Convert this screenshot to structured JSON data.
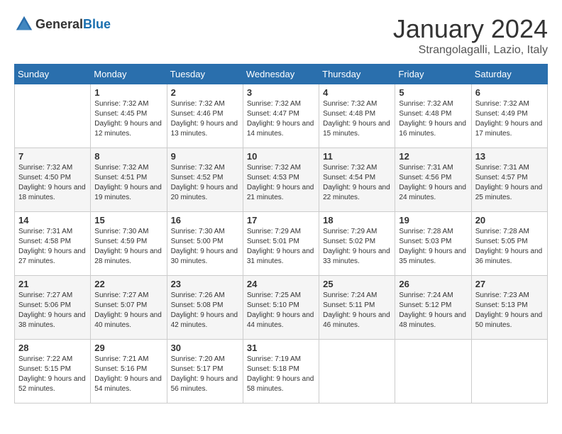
{
  "logo": {
    "text_general": "General",
    "text_blue": "Blue"
  },
  "title": "January 2024",
  "subtitle": "Strangolagalli, Lazio, Italy",
  "days_of_week": [
    "Sunday",
    "Monday",
    "Tuesday",
    "Wednesday",
    "Thursday",
    "Friday",
    "Saturday"
  ],
  "weeks": [
    [
      {
        "day": "",
        "sunrise": "",
        "sunset": "",
        "daylight": ""
      },
      {
        "day": "1",
        "sunrise": "Sunrise: 7:32 AM",
        "sunset": "Sunset: 4:45 PM",
        "daylight": "Daylight: 9 hours and 12 minutes."
      },
      {
        "day": "2",
        "sunrise": "Sunrise: 7:32 AM",
        "sunset": "Sunset: 4:46 PM",
        "daylight": "Daylight: 9 hours and 13 minutes."
      },
      {
        "day": "3",
        "sunrise": "Sunrise: 7:32 AM",
        "sunset": "Sunset: 4:47 PM",
        "daylight": "Daylight: 9 hours and 14 minutes."
      },
      {
        "day": "4",
        "sunrise": "Sunrise: 7:32 AM",
        "sunset": "Sunset: 4:48 PM",
        "daylight": "Daylight: 9 hours and 15 minutes."
      },
      {
        "day": "5",
        "sunrise": "Sunrise: 7:32 AM",
        "sunset": "Sunset: 4:48 PM",
        "daylight": "Daylight: 9 hours and 16 minutes."
      },
      {
        "day": "6",
        "sunrise": "Sunrise: 7:32 AM",
        "sunset": "Sunset: 4:49 PM",
        "daylight": "Daylight: 9 hours and 17 minutes."
      }
    ],
    [
      {
        "day": "7",
        "sunrise": "Sunrise: 7:32 AM",
        "sunset": "Sunset: 4:50 PM",
        "daylight": "Daylight: 9 hours and 18 minutes."
      },
      {
        "day": "8",
        "sunrise": "Sunrise: 7:32 AM",
        "sunset": "Sunset: 4:51 PM",
        "daylight": "Daylight: 9 hours and 19 minutes."
      },
      {
        "day": "9",
        "sunrise": "Sunrise: 7:32 AM",
        "sunset": "Sunset: 4:52 PM",
        "daylight": "Daylight: 9 hours and 20 minutes."
      },
      {
        "day": "10",
        "sunrise": "Sunrise: 7:32 AM",
        "sunset": "Sunset: 4:53 PM",
        "daylight": "Daylight: 9 hours and 21 minutes."
      },
      {
        "day": "11",
        "sunrise": "Sunrise: 7:32 AM",
        "sunset": "Sunset: 4:54 PM",
        "daylight": "Daylight: 9 hours and 22 minutes."
      },
      {
        "day": "12",
        "sunrise": "Sunrise: 7:31 AM",
        "sunset": "Sunset: 4:56 PM",
        "daylight": "Daylight: 9 hours and 24 minutes."
      },
      {
        "day": "13",
        "sunrise": "Sunrise: 7:31 AM",
        "sunset": "Sunset: 4:57 PM",
        "daylight": "Daylight: 9 hours and 25 minutes."
      }
    ],
    [
      {
        "day": "14",
        "sunrise": "Sunrise: 7:31 AM",
        "sunset": "Sunset: 4:58 PM",
        "daylight": "Daylight: 9 hours and 27 minutes."
      },
      {
        "day": "15",
        "sunrise": "Sunrise: 7:30 AM",
        "sunset": "Sunset: 4:59 PM",
        "daylight": "Daylight: 9 hours and 28 minutes."
      },
      {
        "day": "16",
        "sunrise": "Sunrise: 7:30 AM",
        "sunset": "Sunset: 5:00 PM",
        "daylight": "Daylight: 9 hours and 30 minutes."
      },
      {
        "day": "17",
        "sunrise": "Sunrise: 7:29 AM",
        "sunset": "Sunset: 5:01 PM",
        "daylight": "Daylight: 9 hours and 31 minutes."
      },
      {
        "day": "18",
        "sunrise": "Sunrise: 7:29 AM",
        "sunset": "Sunset: 5:02 PM",
        "daylight": "Daylight: 9 hours and 33 minutes."
      },
      {
        "day": "19",
        "sunrise": "Sunrise: 7:28 AM",
        "sunset": "Sunset: 5:03 PM",
        "daylight": "Daylight: 9 hours and 35 minutes."
      },
      {
        "day": "20",
        "sunrise": "Sunrise: 7:28 AM",
        "sunset": "Sunset: 5:05 PM",
        "daylight": "Daylight: 9 hours and 36 minutes."
      }
    ],
    [
      {
        "day": "21",
        "sunrise": "Sunrise: 7:27 AM",
        "sunset": "Sunset: 5:06 PM",
        "daylight": "Daylight: 9 hours and 38 minutes."
      },
      {
        "day": "22",
        "sunrise": "Sunrise: 7:27 AM",
        "sunset": "Sunset: 5:07 PM",
        "daylight": "Daylight: 9 hours and 40 minutes."
      },
      {
        "day": "23",
        "sunrise": "Sunrise: 7:26 AM",
        "sunset": "Sunset: 5:08 PM",
        "daylight": "Daylight: 9 hours and 42 minutes."
      },
      {
        "day": "24",
        "sunrise": "Sunrise: 7:25 AM",
        "sunset": "Sunset: 5:10 PM",
        "daylight": "Daylight: 9 hours and 44 minutes."
      },
      {
        "day": "25",
        "sunrise": "Sunrise: 7:24 AM",
        "sunset": "Sunset: 5:11 PM",
        "daylight": "Daylight: 9 hours and 46 minutes."
      },
      {
        "day": "26",
        "sunrise": "Sunrise: 7:24 AM",
        "sunset": "Sunset: 5:12 PM",
        "daylight": "Daylight: 9 hours and 48 minutes."
      },
      {
        "day": "27",
        "sunrise": "Sunrise: 7:23 AM",
        "sunset": "Sunset: 5:13 PM",
        "daylight": "Daylight: 9 hours and 50 minutes."
      }
    ],
    [
      {
        "day": "28",
        "sunrise": "Sunrise: 7:22 AM",
        "sunset": "Sunset: 5:15 PM",
        "daylight": "Daylight: 9 hours and 52 minutes."
      },
      {
        "day": "29",
        "sunrise": "Sunrise: 7:21 AM",
        "sunset": "Sunset: 5:16 PM",
        "daylight": "Daylight: 9 hours and 54 minutes."
      },
      {
        "day": "30",
        "sunrise": "Sunrise: 7:20 AM",
        "sunset": "Sunset: 5:17 PM",
        "daylight": "Daylight: 9 hours and 56 minutes."
      },
      {
        "day": "31",
        "sunrise": "Sunrise: 7:19 AM",
        "sunset": "Sunset: 5:18 PM",
        "daylight": "Daylight: 9 hours and 58 minutes."
      },
      {
        "day": "",
        "sunrise": "",
        "sunset": "",
        "daylight": ""
      },
      {
        "day": "",
        "sunrise": "",
        "sunset": "",
        "daylight": ""
      },
      {
        "day": "",
        "sunrise": "",
        "sunset": "",
        "daylight": ""
      }
    ]
  ]
}
